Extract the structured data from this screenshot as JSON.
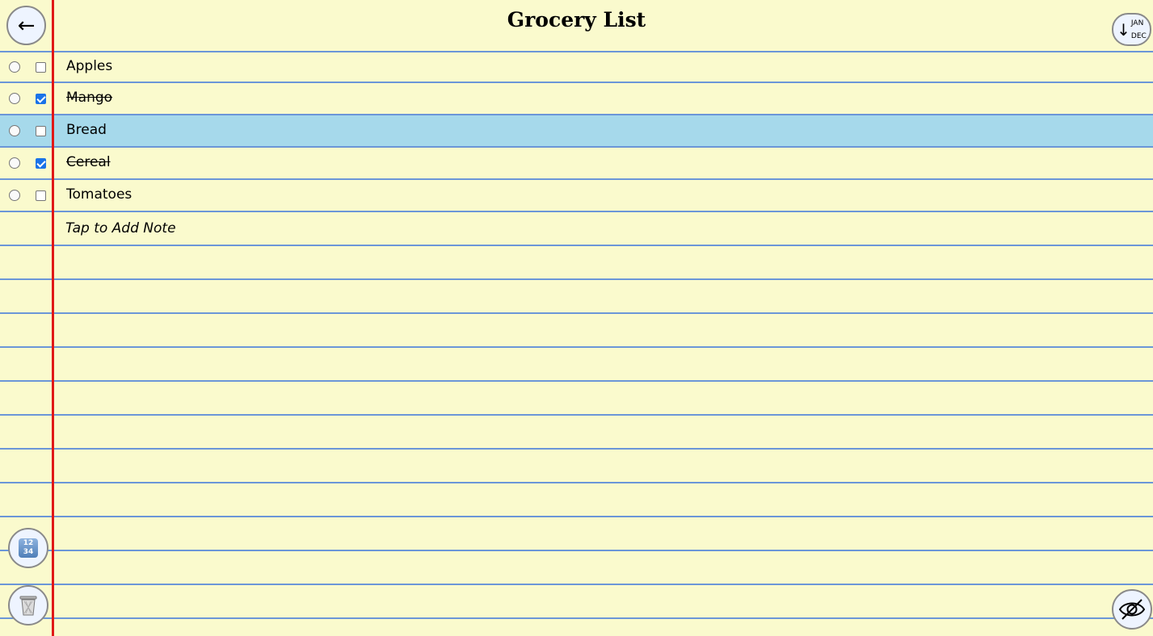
{
  "header": {
    "title": "Grocery List",
    "back_icon": "arrow-left-icon",
    "sort": {
      "icon": "sort-down-icon",
      "from": "JAN",
      "to": "DEC"
    }
  },
  "items": [
    {
      "label": "Apples",
      "checked": false,
      "selected": false
    },
    {
      "label": "Mango",
      "checked": true,
      "selected": false
    },
    {
      "label": "Bread",
      "checked": false,
      "selected": true
    },
    {
      "label": "Cereal",
      "checked": true,
      "selected": false
    },
    {
      "label": "Tomatoes",
      "checked": false,
      "selected": false
    }
  ],
  "add_note": "Tap to Add Note",
  "footer": {
    "numbers_icon": "numbers-1234-icon",
    "numbers_digits": [
      "12",
      "34"
    ],
    "trash_icon": "trash-icon",
    "visibility_icon": "eye-slash-icon"
  },
  "colors": {
    "paper": "#fafacd",
    "rule": "#6b96d8",
    "margin": "#e01818",
    "selected_row": "#a6d9eb",
    "checkbox_on": "#1a73e8"
  }
}
